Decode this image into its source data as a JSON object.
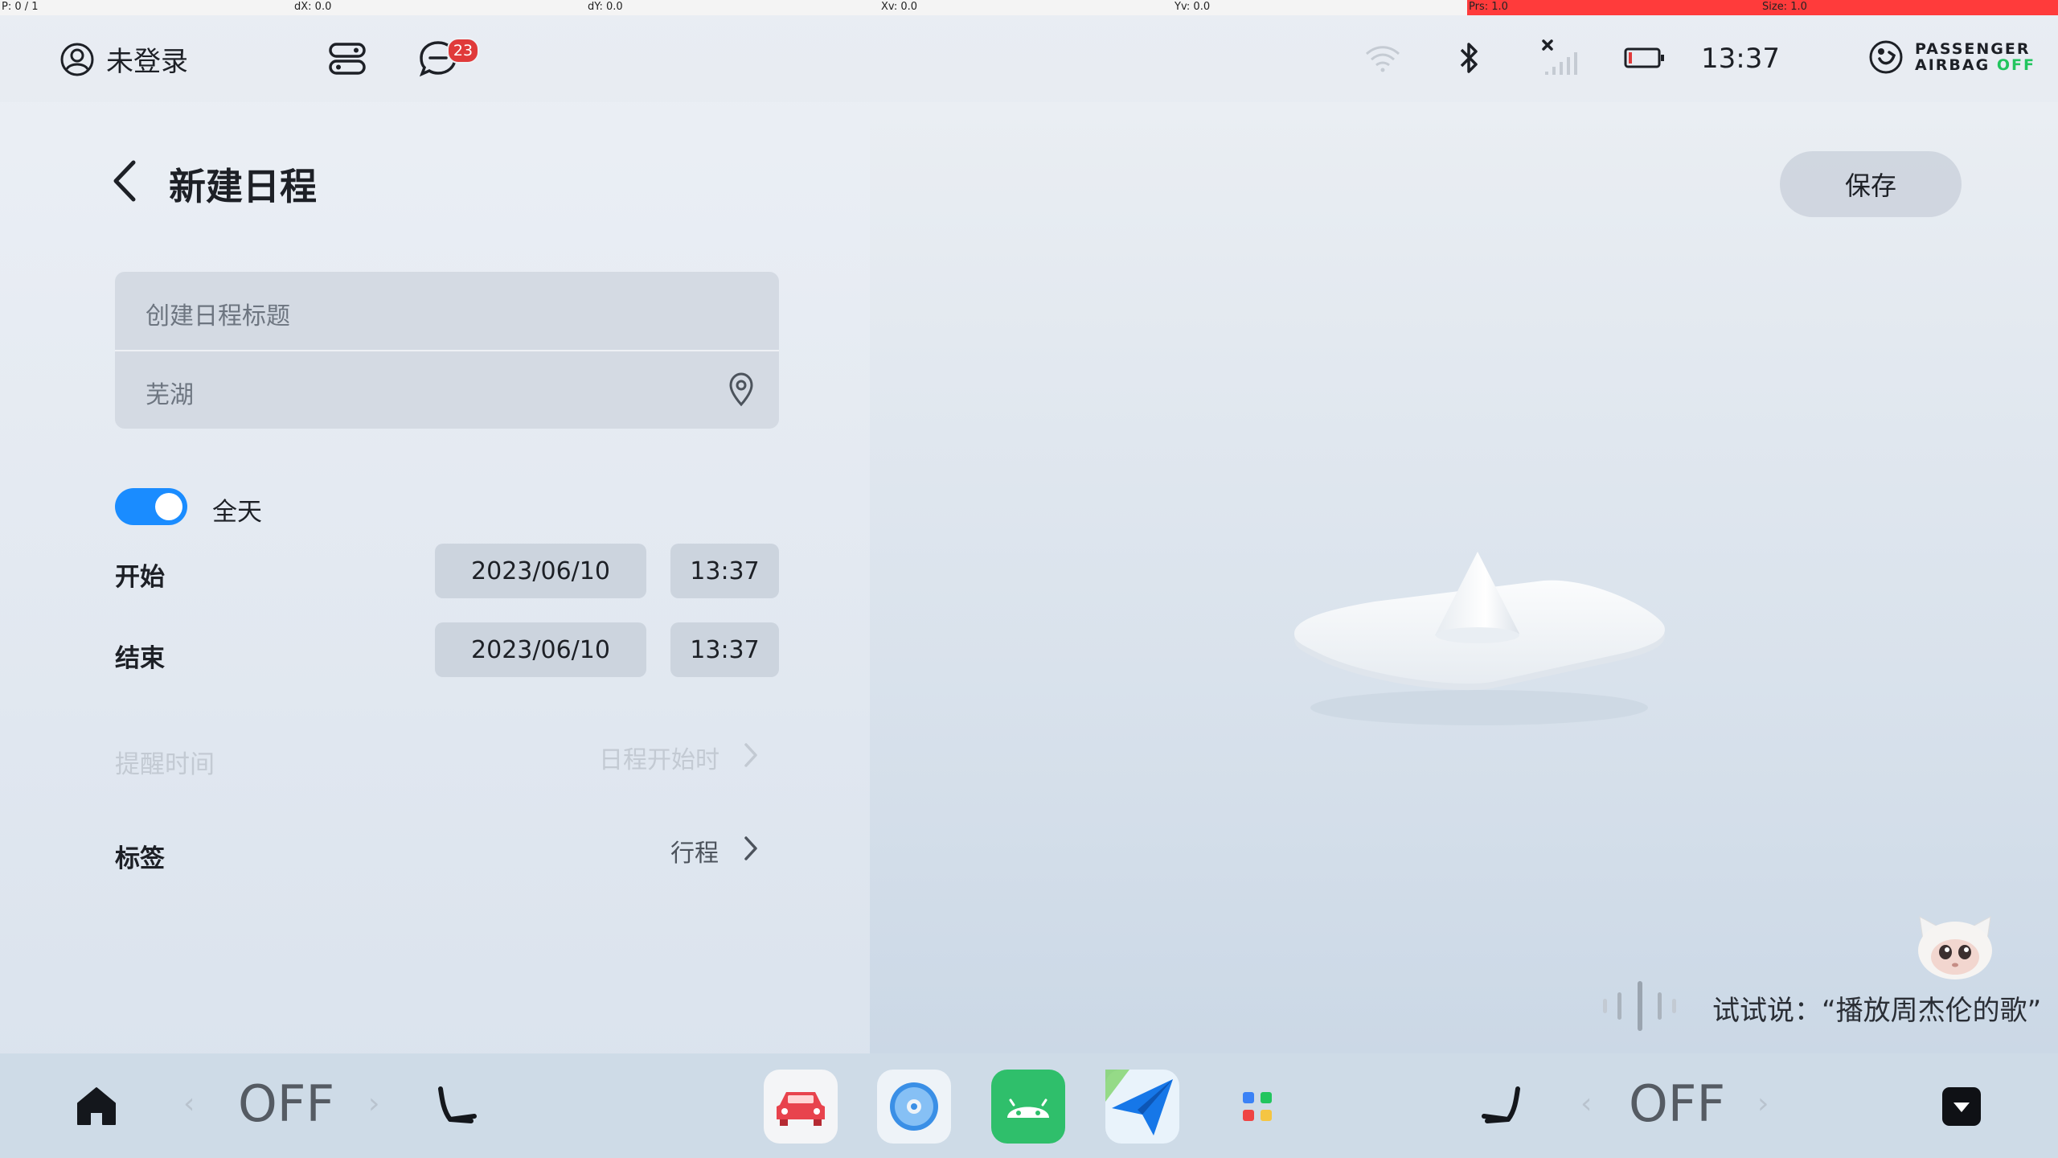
{
  "debug": {
    "p": "P: 0 / 1",
    "dx": "dX: 0.0",
    "dy": "dY: 0.0",
    "xv": "Xv: 0.0",
    "yv": "Yv: 0.0",
    "prs": "Prs: 1.0",
    "size": "Size: 1.0"
  },
  "status": {
    "user_label": "未登录",
    "notification_count": "23",
    "time": "13:37",
    "airbag_line1": "PASSENGER",
    "airbag_line2": "AIRBAG",
    "airbag_state": "OFF",
    "airbag_state_color": "#22c55e"
  },
  "page": {
    "title": "新建日程",
    "save_label": "保存"
  },
  "form": {
    "title_placeholder": "创建日程标题",
    "location_value": "芜湖",
    "all_day_label": "全天",
    "all_day_on": true,
    "start_label": "开始",
    "start_date": "2023/06/10",
    "start_time": "13:37",
    "end_label": "结束",
    "end_date": "2023/06/10",
    "end_time": "13:37",
    "reminder_label": "提醒时间",
    "reminder_value": "日程开始时",
    "tag_label": "标签",
    "tag_value": "行程"
  },
  "assistant": {
    "hint": "试试说：“播放周杰伦的歌”"
  },
  "dock": {
    "left_climate": "OFF",
    "right_climate": "OFF",
    "accent": "#1a8cff"
  }
}
